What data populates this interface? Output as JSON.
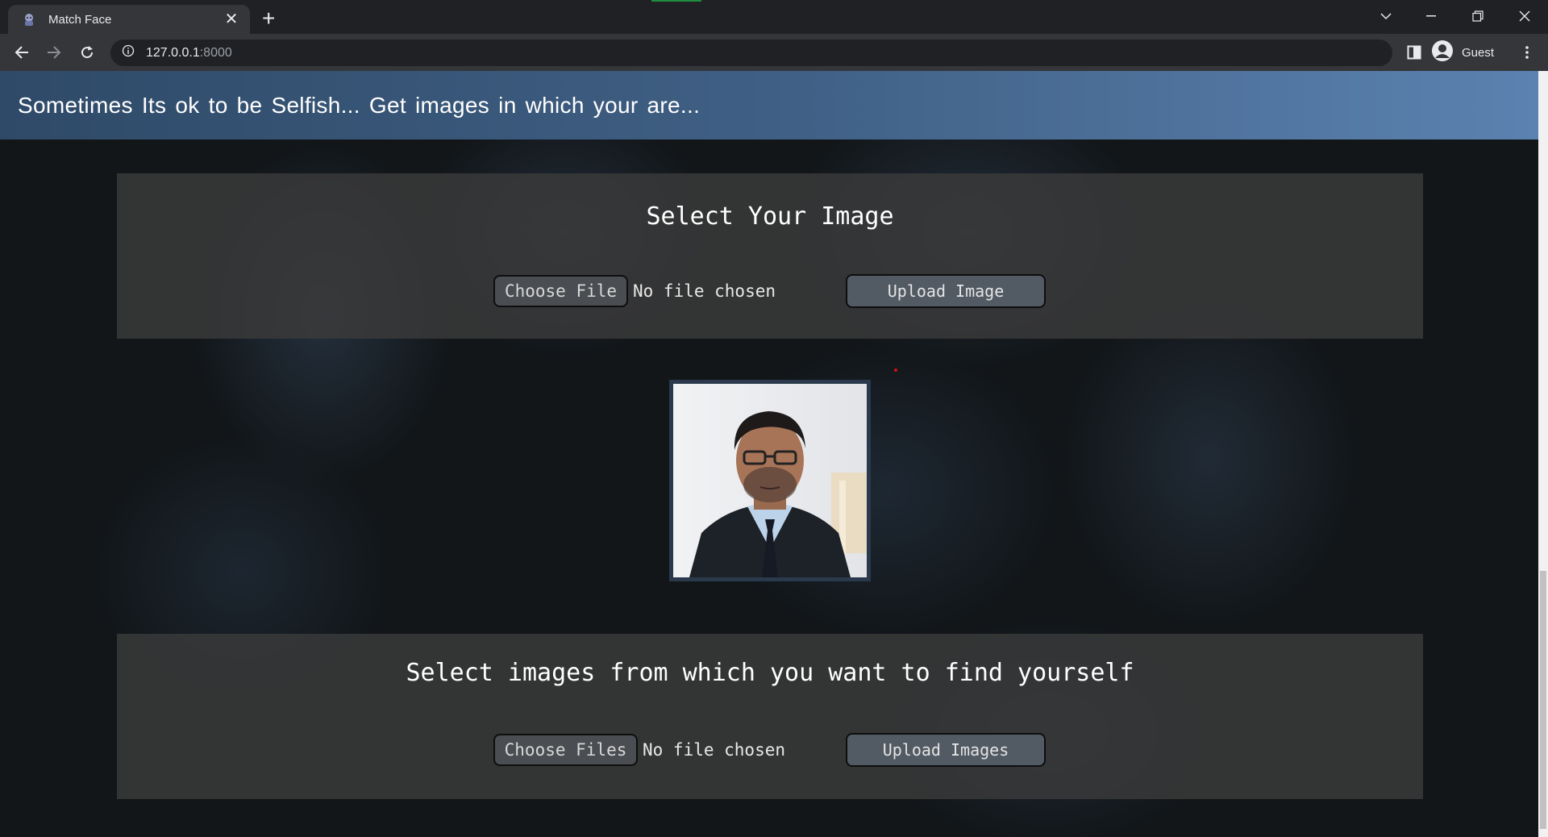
{
  "browser": {
    "tab_title": "Match Face",
    "address_host": "127.0.0.1",
    "address_port": ":8000",
    "profile_label": "Guest"
  },
  "page": {
    "banner_text": "Sometimes Its ok to be Selfish... Get images in which your are...",
    "section_one": {
      "title": "Select Your Image",
      "choose_label": "Choose File",
      "file_status": "No file chosen",
      "upload_label": "Upload Image"
    },
    "section_two": {
      "title": "Select images from which you want to find yourself",
      "choose_label": "Choose Files",
      "file_status": "No file chosen",
      "upload_label": "Upload Images"
    }
  },
  "colors": {
    "banner_start": "#2f4a68",
    "banner_end": "#5b82b0",
    "panel_bg": "#3a3a3a",
    "button_bg": "#4a4d51"
  }
}
